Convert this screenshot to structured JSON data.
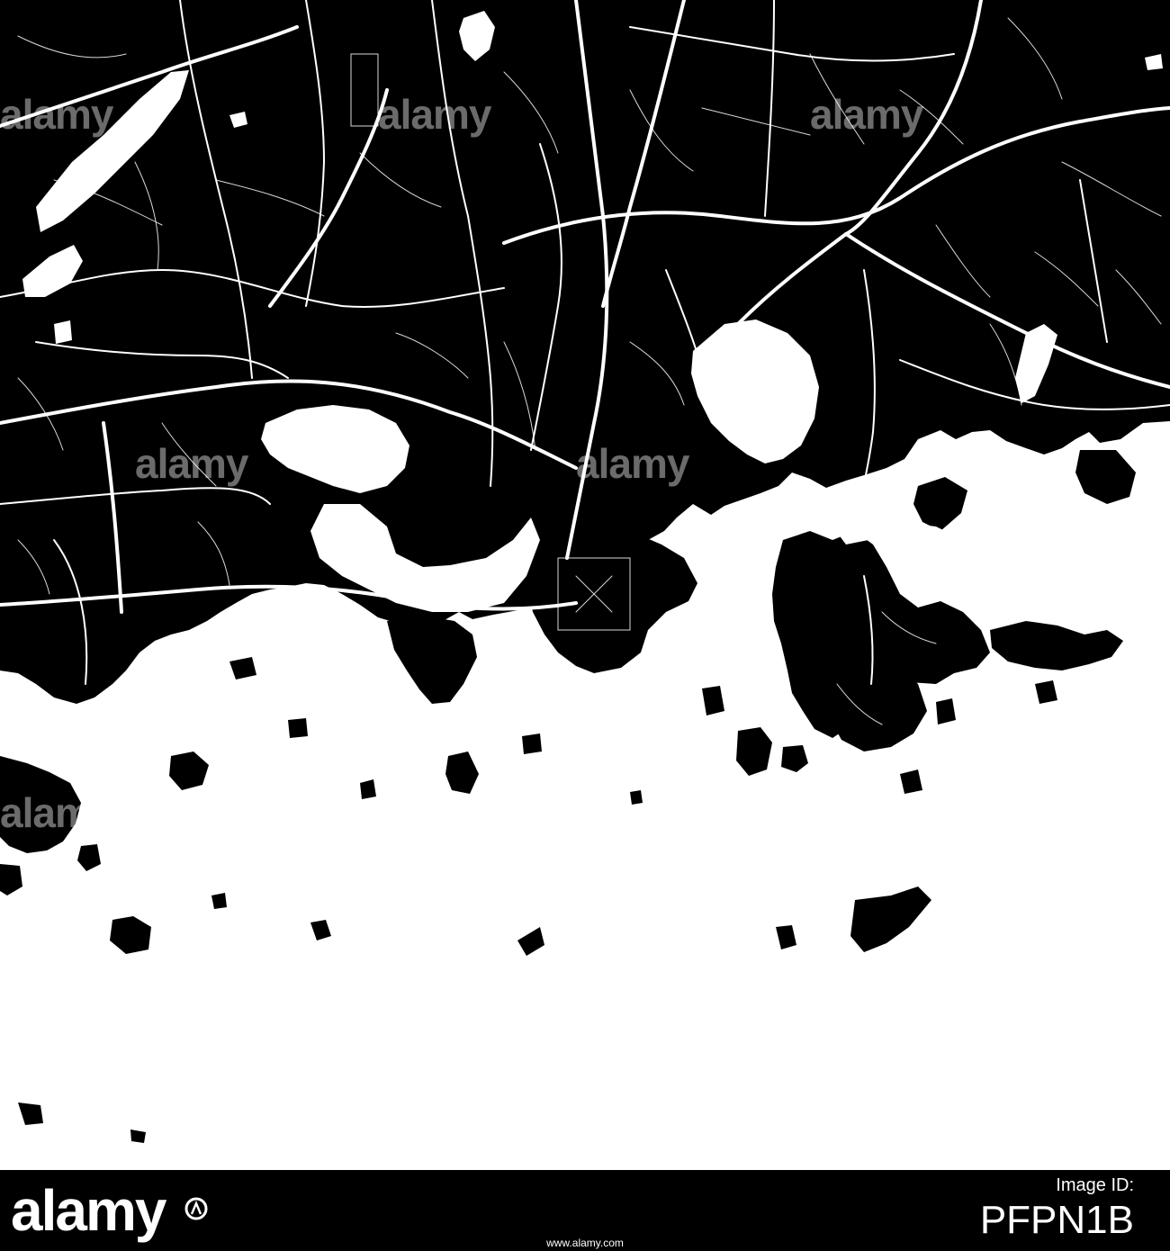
{
  "map": {
    "land_color": "#000000",
    "water_color": "#ffffff",
    "road_color": "#ffffff"
  },
  "watermark": {
    "text": "alamy"
  },
  "footer": {
    "brand": "alamy",
    "brand_icon": "alamy-a-logo-icon",
    "stock_label": "Image ID:",
    "stock_code": "PFPN1B",
    "site": "www.alamy.com"
  }
}
